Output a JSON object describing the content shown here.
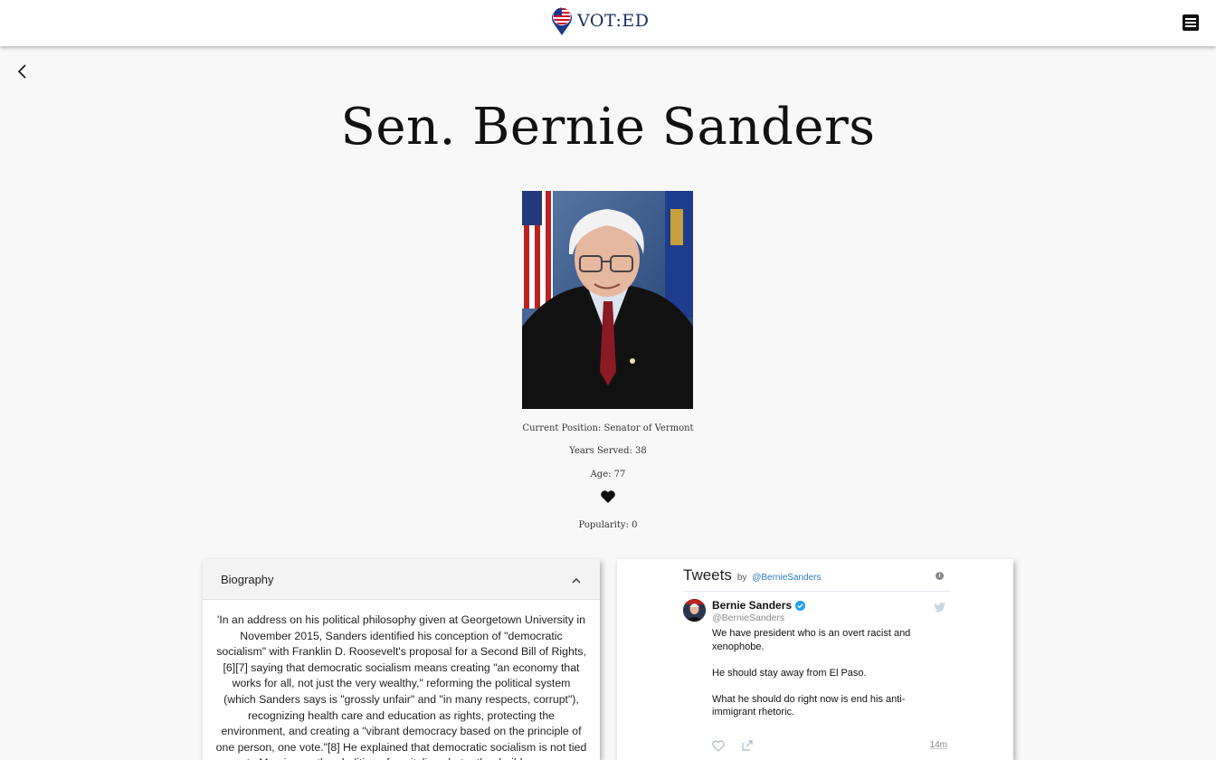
{
  "app": {
    "logo_text": "VOT:ED"
  },
  "icons": {
    "menu": "hamburger-menu-icon",
    "back": "chevron-left-icon",
    "heart": "heart-icon",
    "collapse": "chevron-up-icon",
    "info": "info-icon",
    "twitter": "twitter-bird-icon",
    "like": "heart-outline-icon",
    "share": "share-icon",
    "verified": "verified-badge-icon"
  },
  "profile": {
    "title": "Sen. Bernie Sanders",
    "position": "Current Position: Senator of Vermont",
    "years_served": "Years Served: 38",
    "age": "Age: 77",
    "popularity": "Popularity: 0"
  },
  "biography": {
    "heading": "Biography",
    "text": "'In an address on his political philosophy given at Georgetown University in November 2015, Sanders identified his conception of \"democratic socialism\" with Franklin D. Roosevelt's proposal for a Second Bill of Rights,[6][7] saying that democratic socialism means creating \"an economy that works for all, not just the very wealthy,\" reforming the political system (which Sanders says is \"grossly unfair\" and \"in many respects, corrupt\"), recognizing health care and education as rights, protecting the environment, and creating a \"vibrant democracy based on the principle of one person, one vote.\"[8] He explained that democratic socialism is not tied to Marxism or the abolition of capitalism, but rather builds on ..."
  },
  "tweets": {
    "title": "Tweets",
    "by": "by",
    "handle_link": "@BernieSanders",
    "items": [
      {
        "name": "Bernie Sanders",
        "handle": "@BernieSanders",
        "lines": [
          "We have president who is an overt racist and xenophobe.",
          "He should stay away from El Paso.",
          "What he should do right now is end his anti-immigrant rhetoric."
        ],
        "time": "14m"
      }
    ]
  },
  "colors": {
    "accent_blue": "#2b7bb9",
    "verified_blue": "#1da1f2",
    "logo_navy": "#1c2c5a"
  }
}
